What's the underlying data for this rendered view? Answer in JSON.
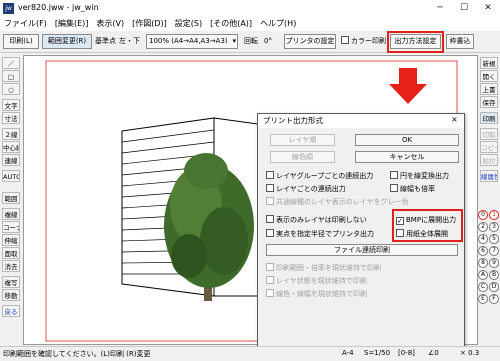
{
  "window": {
    "title": "ver820.jww - jw_win",
    "icon_text": "jw"
  },
  "menu": [
    "ファイル(F)",
    "[編集(E)]",
    "表示(V)",
    "[作図(D)]",
    "設定(S)",
    "[その他(A)]",
    "ヘルプ(H)"
  ],
  "toolbar": {
    "print_label": "印刷(L)",
    "range_change": "範囲変更(R)",
    "reference_point": "基準点",
    "ref_value": "左・下",
    "scale_select": "100% (A4→A4,A3→A3)",
    "rotation_label": "回転",
    "rotation_value": "0°",
    "printer_settings": "プリンタの設定",
    "color_print": "カラー印刷",
    "output_method": "出力方法設定",
    "frame_read": "枠書込"
  },
  "left_tools": [
    "／",
    "□",
    "○",
    "文字",
    "寸法",
    "２線",
    "中心線",
    "連線",
    "AUTO",
    "範囲",
    "複線",
    "コーナー",
    "伸縮",
    "面取",
    "消去",
    "複写",
    "移動",
    "戻る"
  ],
  "right_tools": [
    "新規",
    "開く",
    "上書",
    "保存",
    "印刷",
    "切取",
    "コピー",
    "貼付",
    "線属性"
  ],
  "layer_numbers_a": [
    "0",
    "2",
    "4",
    "6",
    "8",
    "A",
    "C",
    "E"
  ],
  "layer_numbers_b": [
    "1",
    "3",
    "5",
    "7",
    "9",
    "B",
    "D",
    "F"
  ],
  "dialog": {
    "title": "プリント出力形式",
    "close": "×",
    "layer_color": "レイヤ順",
    "line_color": "線色順",
    "ok": "OK",
    "cancel": "キャンセル",
    "options": [
      {
        "label": "レイヤグループごとの連続出力",
        "checked": false,
        "disabled": false
      },
      {
        "label": "円を線変換出力",
        "checked": false,
        "disabled": false
      },
      {
        "label": "レイヤごとの連続出力",
        "checked": false,
        "disabled": false
      },
      {
        "label": "線幅も倍率",
        "checked": false,
        "disabled": false
      },
      {
        "label": "共通線種のレイヤ表示のレイヤをグレー色",
        "checked": false,
        "disabled": true
      },
      {
        "label": "表示のみレイヤは印刷しない",
        "checked": false,
        "disabled": false
      },
      {
        "label": "BMPに展開出力",
        "checked": true,
        "disabled": false
      },
      {
        "label": "実点を指定半径でプリンタ出力",
        "checked": false,
        "disabled": false
      },
      {
        "label": "用紙全体展開",
        "checked": false,
        "disabled": false
      }
    ],
    "file_output_button": "ファイル連続印刷",
    "disabled_options": [
      "印刷範囲・倍率を現状維持で印刷",
      "レイヤ状態を現状維持で印刷",
      "線色・線幅を現状維持で印刷"
    ]
  },
  "status": {
    "message": "印刷範囲を確認してください。(L)印刷 (R)変更",
    "paper": "A-4",
    "scale": "S=1/50",
    "layer": "[0-8]",
    "angle": "∠0",
    "zoom": "× 0.3"
  },
  "colors": {
    "highlight_red": "#e0201b",
    "arrow_red": "#e8201a"
  }
}
